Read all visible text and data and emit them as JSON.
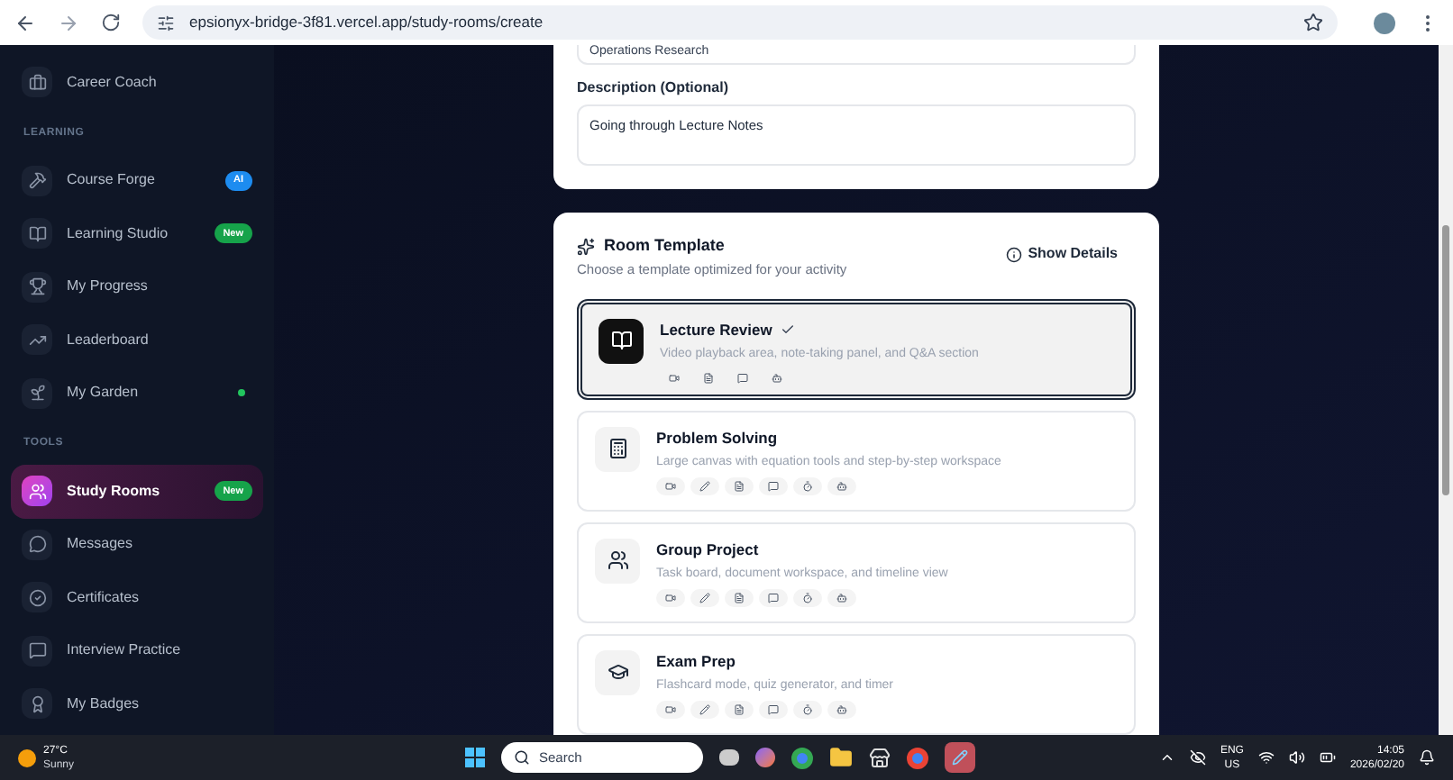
{
  "browser": {
    "url": "epsionyx-bridge-3f81.vercel.app/study-rooms/create"
  },
  "sidebar": {
    "sections": [
      {
        "items": [
          {
            "label": "Career Coach",
            "selected": false
          }
        ]
      },
      {
        "header": "LEARNING",
        "items": [
          {
            "label": "Course Forge",
            "selected": false,
            "badge": {
              "text": "AI",
              "color": "#1d8cf0"
            }
          },
          {
            "label": "Learning Studio",
            "selected": false,
            "badge": {
              "text": "New",
              "color": "#16a34a"
            }
          },
          {
            "label": "My Progress",
            "selected": false
          },
          {
            "label": "Leaderboard",
            "selected": false
          },
          {
            "label": "My Garden",
            "selected": false,
            "dot": {
              "color": "#22c55e"
            }
          }
        ]
      },
      {
        "header": "TOOLS",
        "items": [
          {
            "label": "Study Rooms",
            "selected": true,
            "badge": {
              "text": "New",
              "color": "#16a34a"
            }
          },
          {
            "label": "Messages",
            "selected": false
          },
          {
            "label": "Certificates",
            "selected": false
          },
          {
            "label": "Interview Practice",
            "selected": false
          },
          {
            "label": "My Badges",
            "selected": false
          }
        ]
      }
    ]
  },
  "form": {
    "subject_value": "Operations Research",
    "description": {
      "label": "Description (Optional)",
      "value": "Going through Lecture Notes"
    }
  },
  "template": {
    "title": "Room Template",
    "subtitle": "Choose a template optimized for your activity",
    "details_button": "Show Details",
    "options": [
      {
        "name": "Lecture Review",
        "description": "Video playback area, note-taking panel, and Q&A section",
        "selected": true,
        "features": [
          {
            "kind": "video"
          },
          {
            "kind": "document"
          },
          {
            "kind": "chat"
          },
          {
            "kind": "bot"
          }
        ]
      },
      {
        "name": "Problem Solving",
        "description": "Large canvas with equation tools and step-by-step workspace",
        "selected": false,
        "features": [
          {
            "kind": "video"
          },
          {
            "kind": "pen"
          },
          {
            "kind": "document"
          },
          {
            "kind": "chat"
          },
          {
            "kind": "timer"
          },
          {
            "kind": "bot"
          }
        ]
      },
      {
        "name": "Group Project",
        "description": "Task board, document workspace, and timeline view",
        "selected": false,
        "features": [
          {
            "kind": "video"
          },
          {
            "kind": "pen"
          },
          {
            "kind": "document"
          },
          {
            "kind": "chat"
          },
          {
            "kind": "timer"
          },
          {
            "kind": "bot"
          }
        ]
      },
      {
        "name": "Exam Prep",
        "description": "Flashcard mode, quiz generator, and timer",
        "selected": false,
        "features": [
          {
            "kind": "video"
          },
          {
            "kind": "pen"
          },
          {
            "kind": "document"
          },
          {
            "kind": "chat"
          },
          {
            "kind": "timer"
          },
          {
            "kind": "bot"
          }
        ]
      }
    ]
  },
  "taskbar": {
    "weather": {
      "temp": "27°C",
      "condition": "Sunny"
    },
    "search": "Search",
    "language": {
      "code": "ENG",
      "region": "US"
    },
    "time": "14:05",
    "date": "2026/02/20"
  }
}
